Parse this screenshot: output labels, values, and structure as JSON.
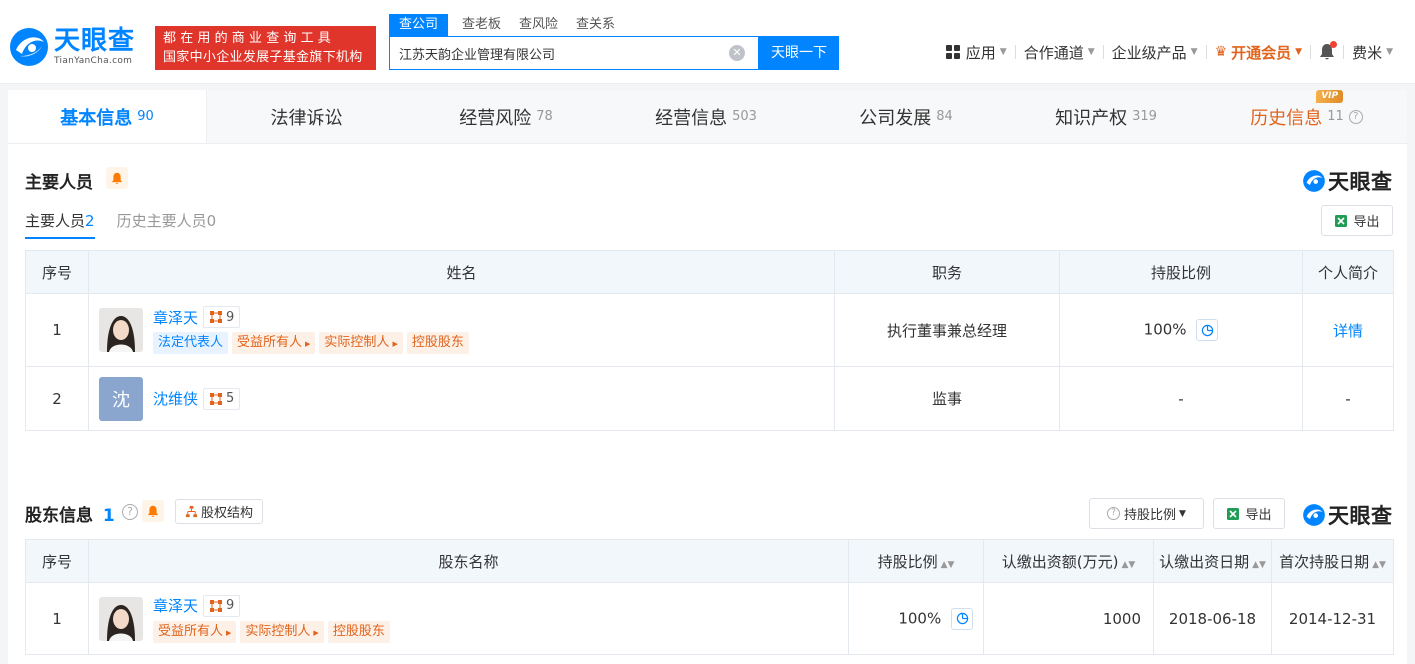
{
  "header": {
    "logo_cn": "天眼查",
    "logo_en": "TianYanCha.com",
    "slogan_line1": "都在用的商业查询工具",
    "slogan_line2": "国家中小企业发展子基金旗下机构",
    "search_tabs": [
      "查公司",
      "查老板",
      "查风险",
      "查关系"
    ],
    "search_value": "江苏天韵企业管理有限公司",
    "search_button": "天眼一下",
    "nav": {
      "apps": "应用",
      "partner": "合作通道",
      "enterprise": "企业级产品",
      "vip": "开通会员",
      "user": "费米"
    }
  },
  "tabs": [
    {
      "label": "基本信息",
      "count": "90"
    },
    {
      "label": "法律诉讼",
      "count": ""
    },
    {
      "label": "经营风险",
      "count": "78"
    },
    {
      "label": "经营信息",
      "count": "503"
    },
    {
      "label": "公司发展",
      "count": "84"
    },
    {
      "label": "知识产权",
      "count": "319"
    },
    {
      "label": "历史信息",
      "count": "11",
      "badge": "VIP"
    }
  ],
  "personnel": {
    "title": "主要人员",
    "brand": "天眼查",
    "subtab_current": "主要人员",
    "subtab_current_count": "2",
    "subtab_history": "历史主要人员",
    "subtab_history_count": "0",
    "export": "导出",
    "columns": [
      "序号",
      "姓名",
      "职务",
      "持股比例",
      "个人简介"
    ],
    "rows": [
      {
        "index": "1",
        "name": "章泽天",
        "rel_count": "9",
        "tags": [
          "法定代表人",
          "受益所有人",
          "实际控制人",
          "控股股东"
        ],
        "position": "执行董事兼总经理",
        "ratio": "100%",
        "bio": "详情"
      },
      {
        "index": "2",
        "name": "沈维侠",
        "avatar_letter": "沈",
        "rel_count": "5",
        "tags": [],
        "position": "监事",
        "ratio": "-",
        "bio": "-"
      }
    ]
  },
  "shareholders": {
    "title": "股东信息",
    "count": "1",
    "equity_button": "股权结构",
    "ratio_filter": "持股比例",
    "export": "导出",
    "brand": "天眼查",
    "columns": [
      "序号",
      "股东名称",
      "持股比例",
      "认缴出资额(万元)",
      "认缴出资日期",
      "首次持股日期"
    ],
    "rows": [
      {
        "index": "1",
        "name": "章泽天",
        "rel_count": "9",
        "tags": [
          "受益所有人",
          "实际控制人",
          "控股股东"
        ],
        "ratio": "100%",
        "amount": "1000",
        "date": "2018-06-18",
        "first_date": "2014-12-31"
      }
    ]
  },
  "colors": {
    "accent": "#0084ff",
    "orange": "#e0641c",
    "red": "#e0352b"
  }
}
